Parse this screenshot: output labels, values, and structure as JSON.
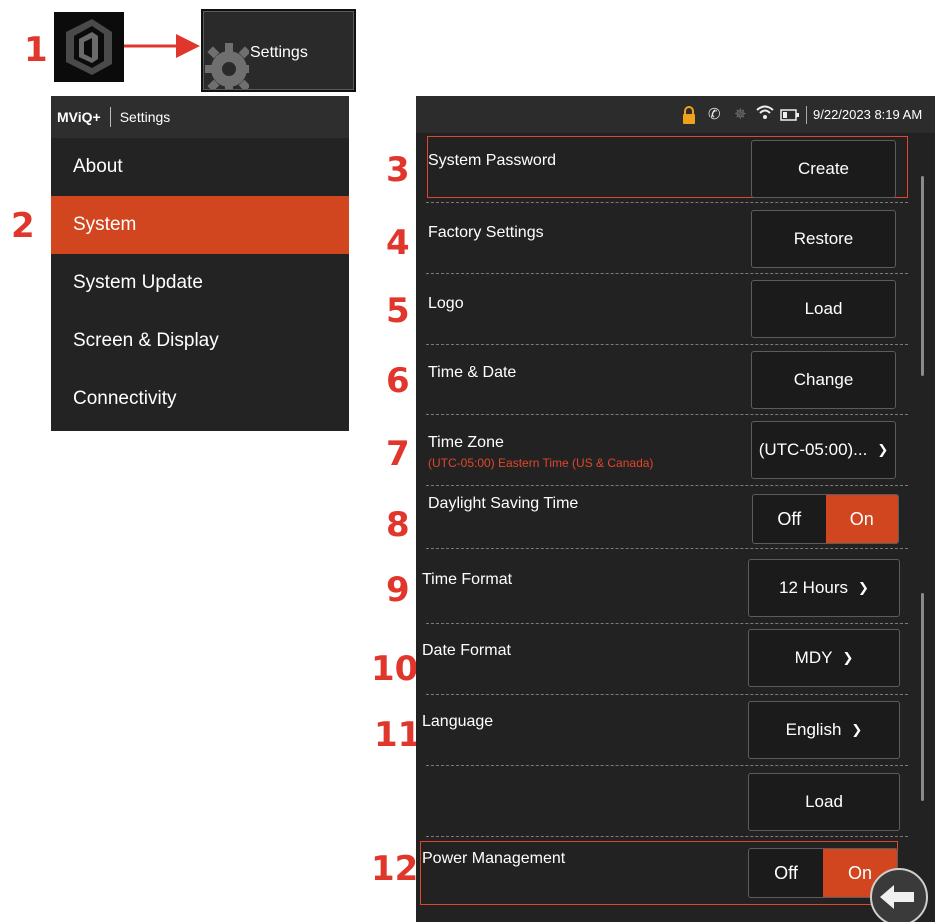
{
  "callouts": [
    "1",
    "2",
    "3",
    "4",
    "5",
    "6",
    "7",
    "8",
    "9",
    "10",
    "11",
    "12"
  ],
  "settings_tile": {
    "label": "Settings"
  },
  "menu": {
    "brand": "MViQ+",
    "title": "Settings",
    "items": [
      {
        "label": "About"
      },
      {
        "label": "System"
      },
      {
        "label": "System Update"
      },
      {
        "label": "Screen & Display"
      },
      {
        "label": "Connectivity"
      }
    ],
    "active_index": 1
  },
  "status_bar": {
    "datetime": "9/22/2023 8:19 AM"
  },
  "settings": {
    "system_password": {
      "label": "System Password",
      "button": "Create"
    },
    "factory_settings": {
      "label": "Factory Settings",
      "button": "Restore"
    },
    "logo": {
      "label": "Logo",
      "button": "Load"
    },
    "time_date": {
      "label": "Time & Date",
      "button": "Change"
    },
    "time_zone": {
      "label": "Time Zone",
      "subtitle": "(UTC-05:00) Eastern Time (US & Canada)",
      "value": "(UTC-05:00)..."
    },
    "daylight_saving": {
      "label": "Daylight Saving Time",
      "off": "Off",
      "on": "On",
      "selected": "On"
    },
    "time_format": {
      "label": "Time Format",
      "value": "12 Hours"
    },
    "date_format": {
      "label": "Date Format",
      "value": "MDY"
    },
    "language": {
      "label": "Language",
      "value": "English"
    },
    "unnamed_load": {
      "button": "Load"
    },
    "power_management": {
      "label": "Power Management",
      "off": "Off",
      "on": "On",
      "selected": "On"
    }
  },
  "colors": {
    "accent": "#d2461f",
    "callout": "#e0362c",
    "panel": "#222222"
  }
}
